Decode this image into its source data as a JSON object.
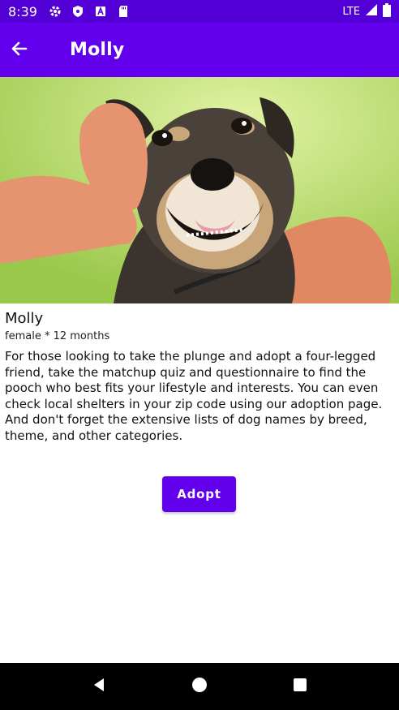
{
  "status_bar": {
    "time": "8:39",
    "network": "LTE",
    "icons": [
      "gear-icon",
      "shield-icon",
      "text-icon",
      "sd-card-icon"
    ]
  },
  "app_bar": {
    "title": "Molly",
    "back_icon": "arrow-left-icon"
  },
  "pet": {
    "name": "Molly",
    "meta": "female  * 12 months",
    "description": "For those looking to take the plunge and adopt a four-legged friend, take the matchup quiz and questionnaire to find the pooch who best fits your lifestyle and interests. You can even check local shelters in your zip code using our adoption page. And don't forget the extensive lists of dog names by breed, theme, and other categories."
  },
  "actions": {
    "adopt_label": "Adopt"
  },
  "colors": {
    "primary": "#6200ee",
    "status_bar": "#5300d6"
  }
}
